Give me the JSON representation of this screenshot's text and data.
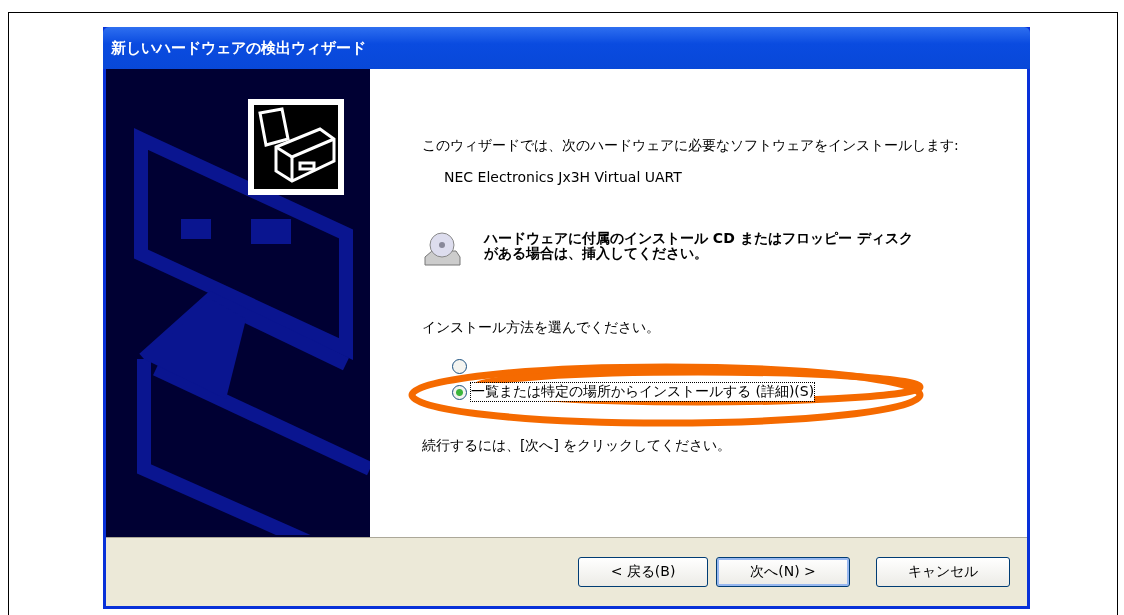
{
  "window": {
    "title": "新しいハードウェアの検出ウィザード"
  },
  "intro": "このウィザードでは、次のハードウェアに必要なソフトウェアをインストールします:",
  "device": "NEC Electronics Jx3H Virtual UART",
  "cd_notice": "ハードウェアに付属のインストール CD またはフロッピー ディスクがある場合は、挿入してください。",
  "prompt": "インストール方法を選んでください。",
  "options": [
    {
      "selected": false
    },
    {
      "label": "一覧または特定の場所からインストールする (詳細)(S)",
      "selected": true
    }
  ],
  "footer_text": "続行するには、[次へ] をクリックしてください。",
  "buttons": [
    {
      "label": "< 戻る(B)",
      "default": false
    },
    {
      "label": "次へ(N) >",
      "default": true
    },
    {
      "label": "キャンセル",
      "default": false
    }
  ]
}
